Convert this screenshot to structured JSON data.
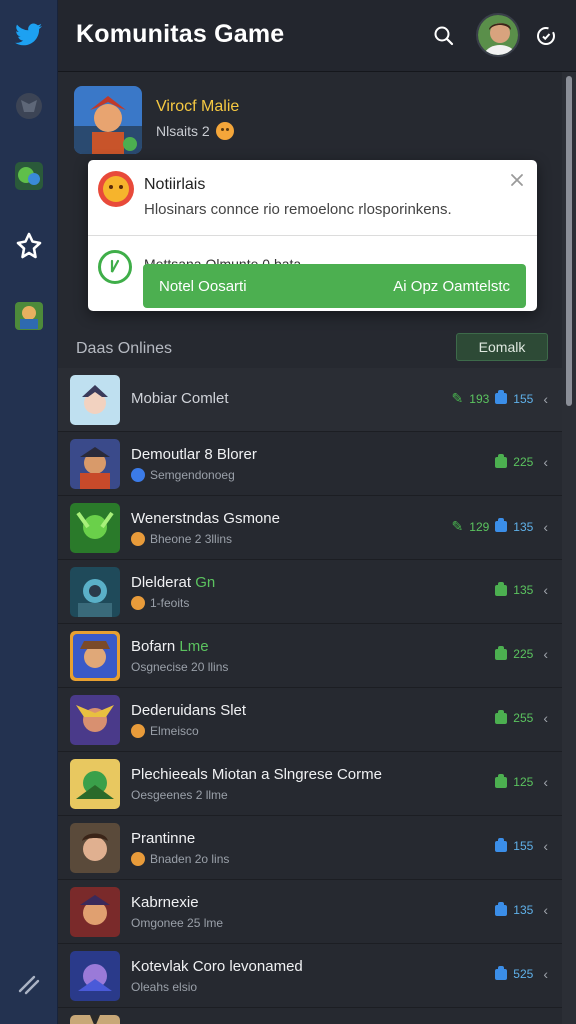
{
  "header": {
    "title": "Komunitas Game"
  },
  "sidebar": {
    "items": [
      {
        "icon": "bird-icon"
      },
      {
        "icon": "game-icon-1"
      },
      {
        "icon": "game-icon-2"
      },
      {
        "icon": "star-icon"
      },
      {
        "icon": "game-icon-3"
      },
      {
        "icon": "collapse-icon"
      }
    ]
  },
  "featured": {
    "name": "Virocf Malie",
    "meta": "Nlsaits 2"
  },
  "notification": {
    "title": "Notiirlais",
    "message": "Hlosinars connce rio remoelonc rlosporinkens.",
    "sub": "Mettsana Olmunte 0 bata",
    "action_left": "Notel Oosarti",
    "action_right": "Ai Opz Oamtelstc"
  },
  "online": {
    "label": "Daas Onlines",
    "button": "Eomalk"
  },
  "rows": [
    {
      "title": "Mobiar Comlet",
      "sub": "",
      "pencil_num": "193",
      "badge_num": "155",
      "badge": "blue"
    },
    {
      "title": "Demoutlar 8 Blorer",
      "sub": "Semgendonoeg",
      "badge_num": "225",
      "badge": "green"
    },
    {
      "title": "Wenerstndas Gsmone",
      "sub": "Bheone 2 3llins",
      "pencil_num": "129",
      "badge_num": "135",
      "badge": "blue"
    },
    {
      "title": "Dlelderat",
      "title_accent": "Gn",
      "sub": "1-feoits",
      "badge_num": "135",
      "badge": "green"
    },
    {
      "title": "Bofarn",
      "title_accent": "Lme",
      "sub": "Osgnecise 20 llins",
      "badge_num": "225",
      "badge": "green"
    },
    {
      "title": "Dederuidans Slet",
      "sub": "Elmeisco",
      "badge_num": "255",
      "badge": "green"
    },
    {
      "title": "Plechieeals Miotan a Slngrese Corme",
      "sub": "Oesgeenes 2 llme",
      "badge_num": "125",
      "badge": "green"
    },
    {
      "title": "Prantinne",
      "sub": "Bnaden 2o lins",
      "badge_num": "155",
      "badge": "blue"
    },
    {
      "title": "Kabrnexie",
      "sub": "Omgonee 25 lme",
      "badge_num": "135",
      "badge": "blue"
    },
    {
      "title": "Kotevlak Coro levonamed",
      "sub": "Oleahs elsio",
      "badge_num": "525",
      "badge": "blue"
    }
  ]
}
